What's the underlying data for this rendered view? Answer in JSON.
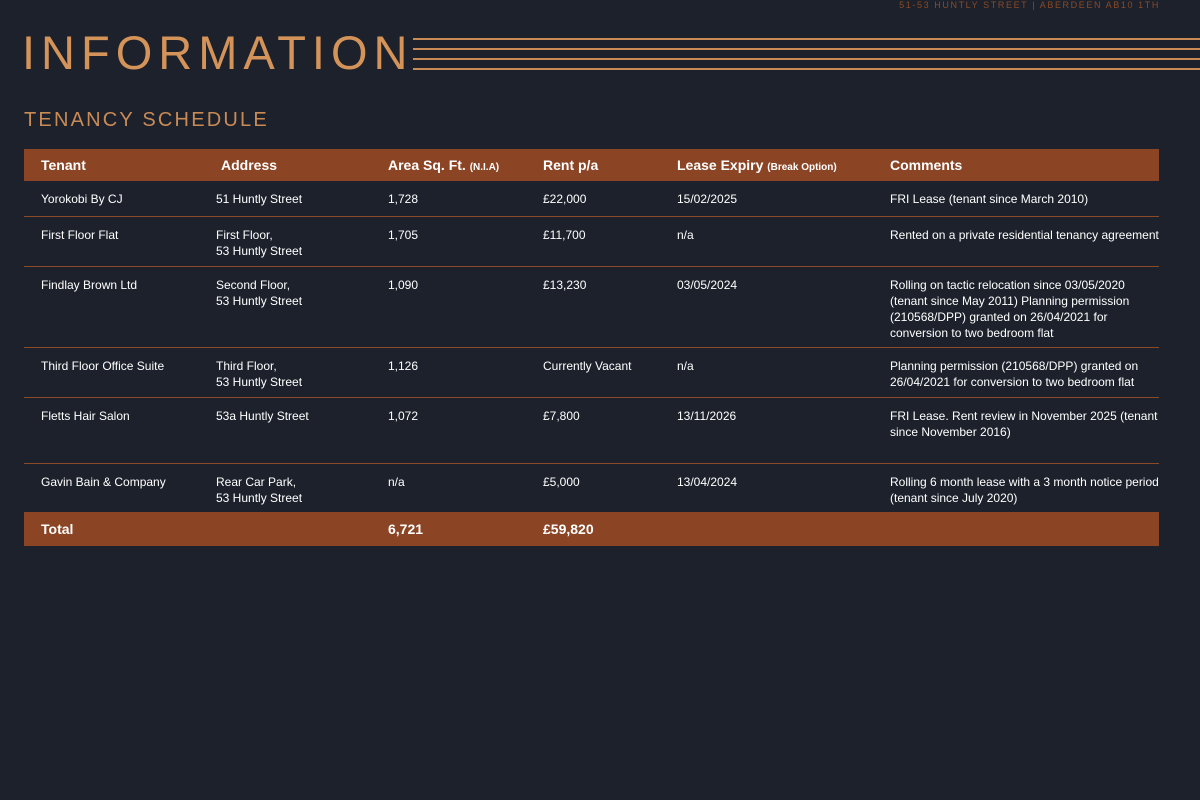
{
  "page": {
    "address": "51-53 HUNTLY STREET | ABERDEEN AB10 1TH",
    "title": "INFORMATION",
    "section_title": "TENANCY SCHEDULE"
  },
  "table": {
    "headers": {
      "tenant": "Tenant",
      "address": "Address",
      "area": "Area Sq. Ft.",
      "area_note": "(N.I.A)",
      "rent": "Rent p/a",
      "expiry": "Lease Expiry",
      "expiry_note": "(Break Option)",
      "comments": "Comments"
    },
    "rows": [
      {
        "tenant": "Yorokobi By CJ",
        "address_line1": "51 Huntly Street",
        "address_line2": "",
        "area": "1,728",
        "rent": "£22,000",
        "expiry": "15/02/2025",
        "comments": "FRI Lease (tenant since March 2010)"
      },
      {
        "tenant": "First Floor Flat",
        "address_line1": "First Floor,",
        "address_line2": "53 Huntly Street",
        "area": "1,705",
        "rent": "£11,700",
        "expiry": "n/a",
        "comments": "Rented on a private residential tenancy agreement"
      },
      {
        "tenant": "Findlay Brown Ltd",
        "address_line1": "Second Floor,",
        "address_line2": "53 Huntly Street",
        "area": "1,090",
        "rent": "£13,230",
        "expiry": "03/05/2024",
        "comments": "Rolling on tactic relocation since 03/05/2020 (tenant since May 2011) Planning permission (210568/DPP) granted on 26/04/2021 for conversion to two bedroom flat"
      },
      {
        "tenant": "Third Floor Office Suite",
        "address_line1": "Third Floor,",
        "address_line2": "53 Huntly Street",
        "area": "1,126",
        "rent": "Currently Vacant",
        "expiry": "n/a",
        "comments": "Planning permission (210568/DPP) granted on 26/04/2021 for conversion to two bedroom flat"
      },
      {
        "tenant": "Fletts Hair Salon",
        "address_line1": "53a Huntly Street",
        "address_line2": "",
        "area": "1,072",
        "rent": "£7,800",
        "expiry": "13/11/2026",
        "comments": "FRI Lease. Rent review in November 2025 (tenant since November 2016)"
      },
      {
        "tenant": "Gavin Bain & Company",
        "address_line1": "Rear Car Park,",
        "address_line2": "53 Huntly Street",
        "area": "n/a",
        "rent": "£5,000",
        "expiry": "13/04/2024",
        "comments": "Rolling 6 month lease with a 3 month notice period (tenant since July 2020)"
      }
    ],
    "total": {
      "label": "Total",
      "area": "6,721",
      "rent": "£59,820"
    }
  },
  "colors": {
    "background": "#1c212b",
    "accent": "#d49359",
    "table_band": "#8b4424"
  }
}
